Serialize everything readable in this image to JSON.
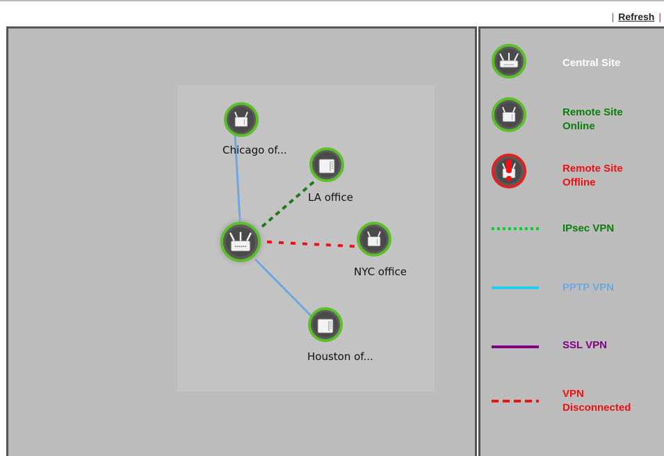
{
  "toolbar": {
    "refresh_label": "Refresh",
    "separator": "|"
  },
  "nodes": {
    "chicago": "Chicago of...",
    "la": "LA office",
    "nyc": "NYC office",
    "houston": "Houston of..."
  },
  "legend": {
    "central_site": "Central Site",
    "remote_online": "Remote Site Online",
    "remote_offline": "Remote Site Offline",
    "ipsec_vpn": "IPsec VPN",
    "pptp_vpn": "PPTP VPN",
    "ssl_vpn": "SSL VPN",
    "vpn_disconnected": "VPN Disconnected"
  },
  "colors": {
    "online_green": "#0a7d0a",
    "offline_red": "#ee1111",
    "pptp_blue": "#6ea6e0",
    "ipsec_green": "#00cc33",
    "ssl_purple": "#800080",
    "central_white": "#ffffff"
  }
}
